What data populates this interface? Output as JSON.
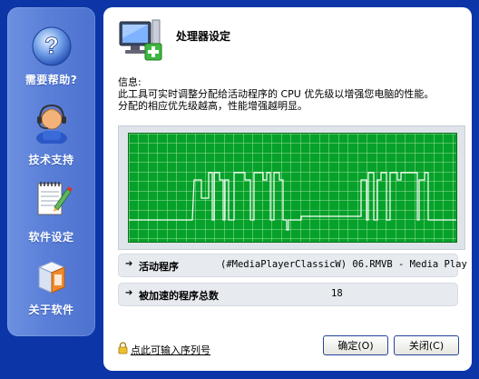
{
  "sidebar": {
    "items": [
      {
        "label": "需要帮助?",
        "icon": "help-icon"
      },
      {
        "label": "技术支持",
        "icon": "support-agent-icon"
      },
      {
        "label": "软件设定",
        "icon": "settings-notepad-icon"
      },
      {
        "label": "关于软件",
        "icon": "about-box-icon"
      }
    ]
  },
  "main": {
    "title": "处理器设定",
    "info_heading": "信息:",
    "info_line1": "此工具可实时调整分配给活动程序的 CPU 优先级以增强您电脑的性能。",
    "info_line2": "分配的相应优先级越高，性能增强越明显。",
    "active_program": {
      "label": "活动程序",
      "value": "(#MediaPlayerClassicW) 06.RMVB - Media Play"
    },
    "boosted_count": {
      "label": "被加速的程序总数",
      "value": "18"
    },
    "serial_link": "点此可输入序列号",
    "ok_button": "确定(O)",
    "close_button": "关闭(C)"
  },
  "colors": {
    "background": "#0c36a8",
    "sidebar": "#5a7fd8",
    "graph_bg": "#06a12a",
    "graph_grid": "#9ee39e",
    "graph_line": "#ffffff"
  }
}
